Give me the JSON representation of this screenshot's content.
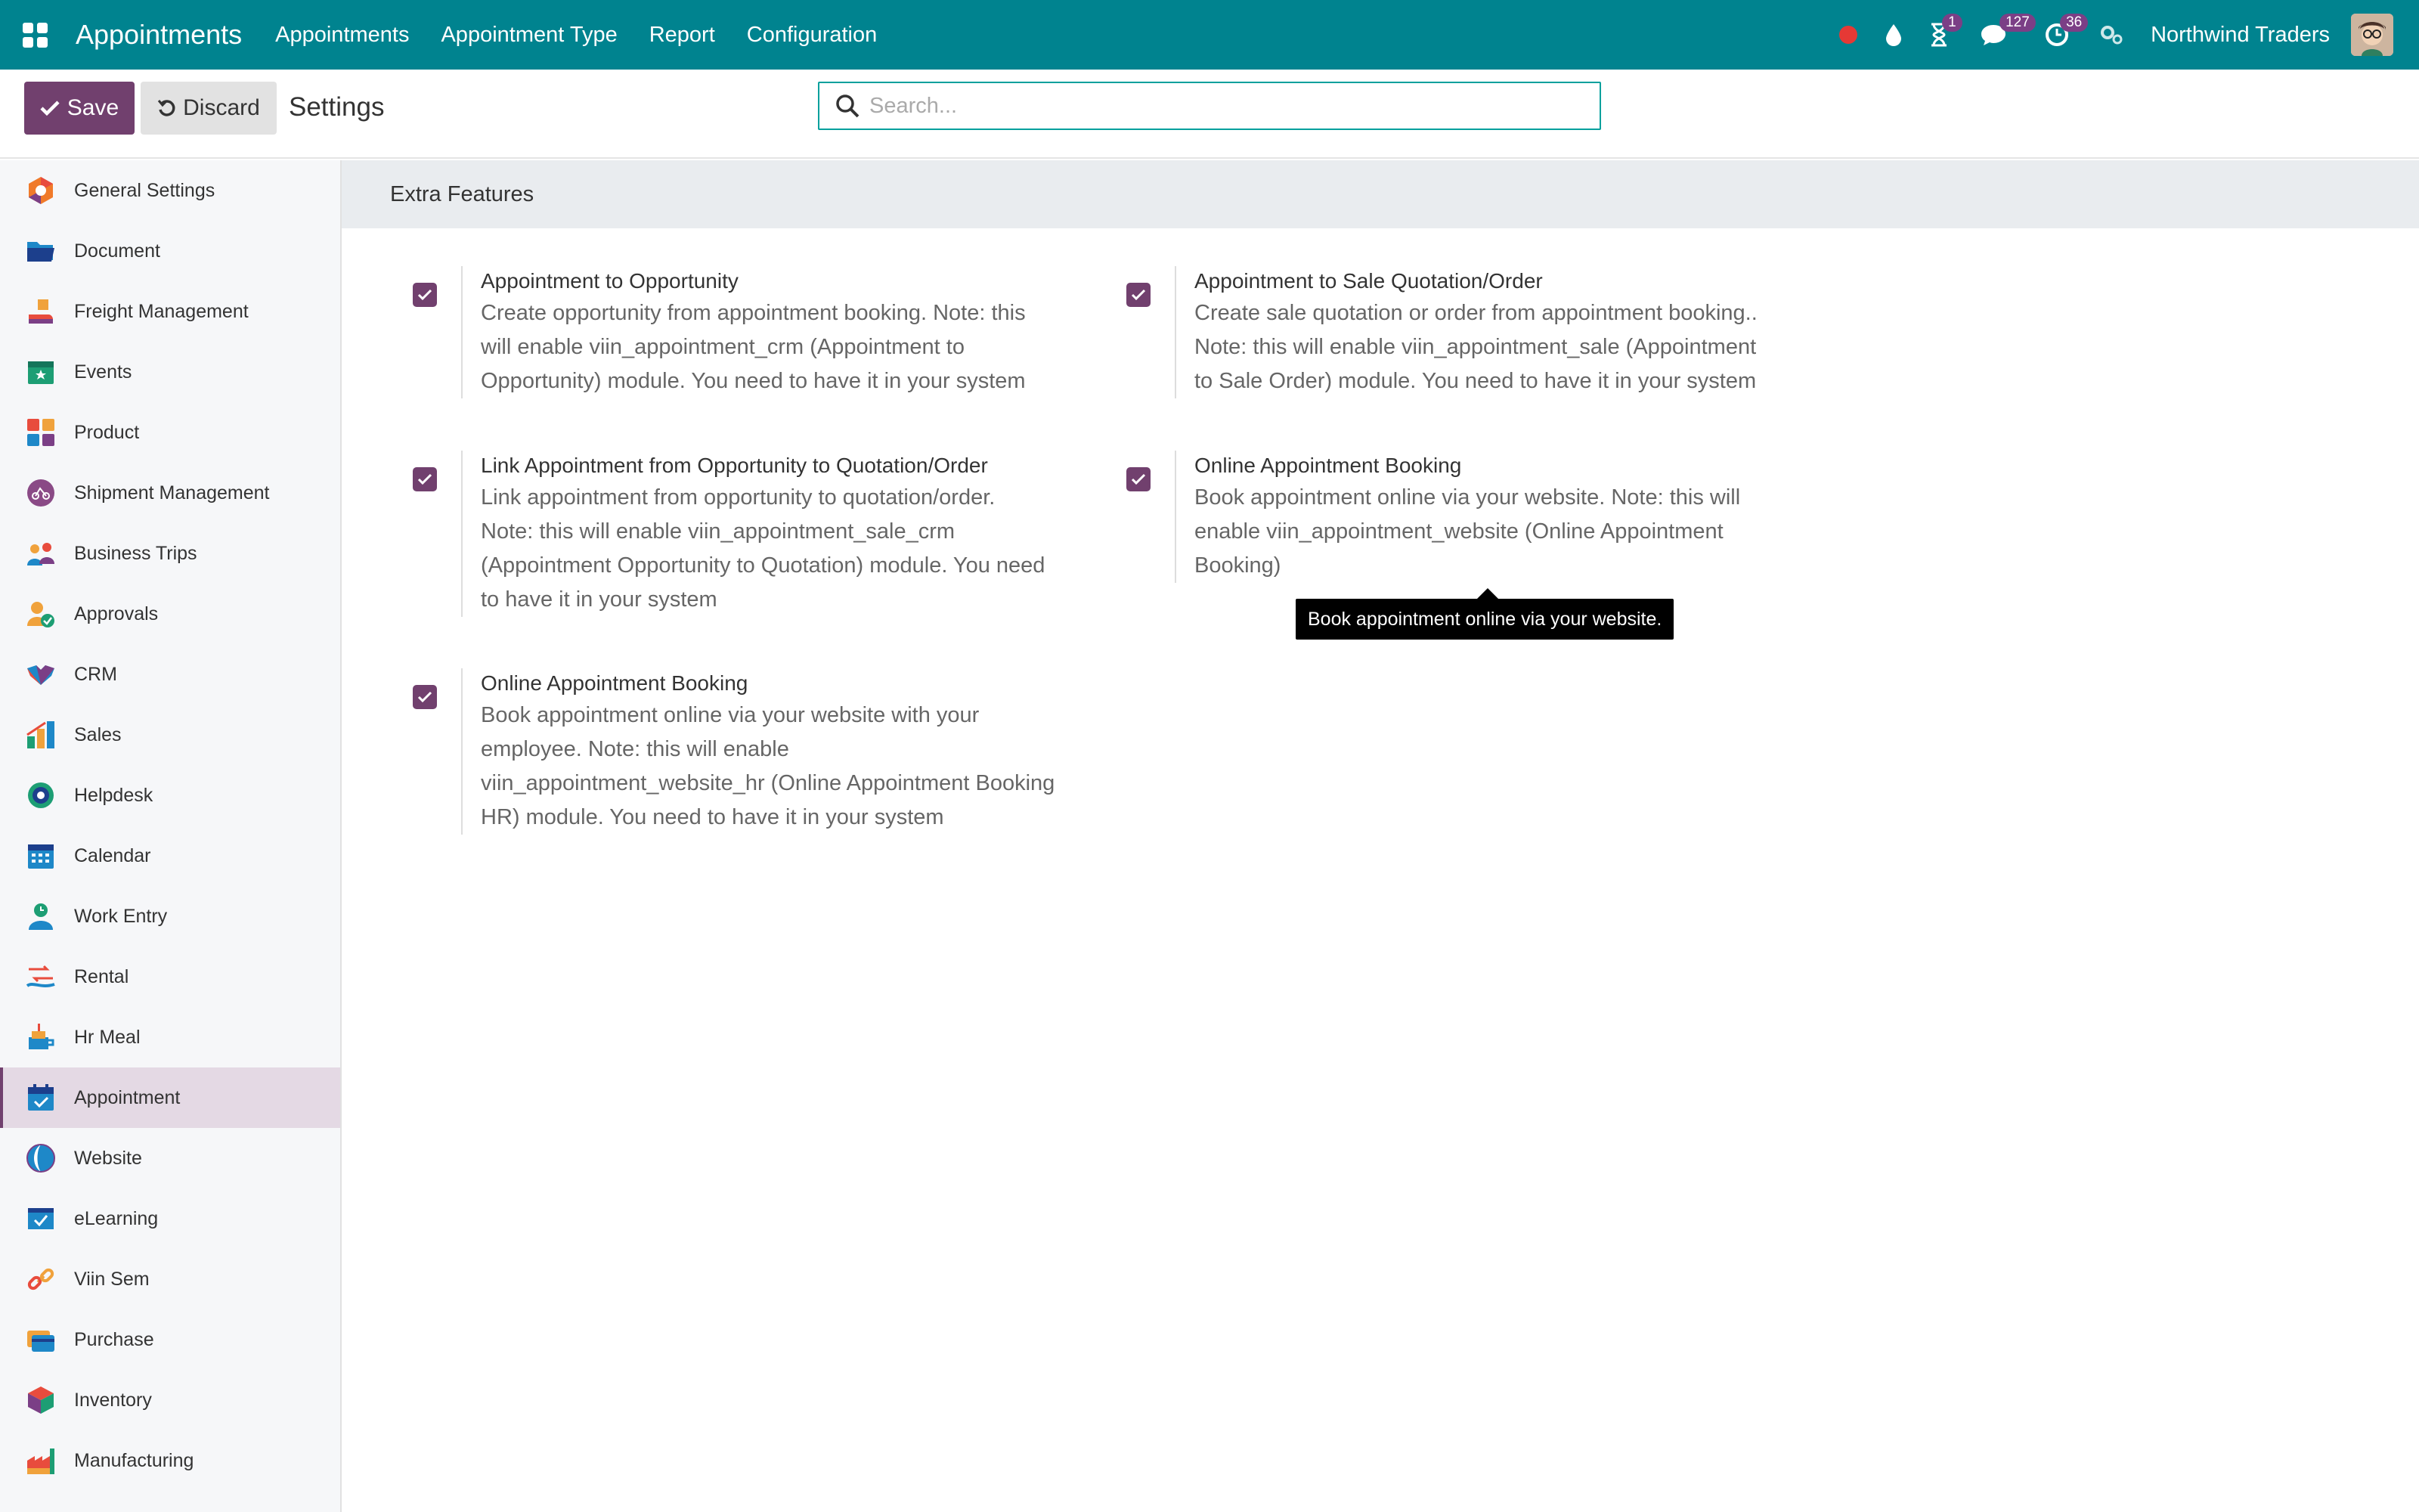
{
  "navbar": {
    "brand": "Appointments",
    "menu": [
      "Appointments",
      "Appointment Type",
      "Report",
      "Configuration"
    ],
    "activity_badge": "1",
    "messages_badge": "127",
    "timer_badge": "36",
    "company": "Northwind Traders"
  },
  "control": {
    "save_label": "Save",
    "discard_label": "Discard",
    "title": "Settings",
    "search_placeholder": "Search..."
  },
  "sidebar": {
    "items": [
      {
        "label": "General Settings",
        "icon": "general-settings-icon"
      },
      {
        "label": "Document",
        "icon": "folder-icon"
      },
      {
        "label": "Freight Management",
        "icon": "freight-icon"
      },
      {
        "label": "Events",
        "icon": "events-icon"
      },
      {
        "label": "Product",
        "icon": "product-icon"
      },
      {
        "label": "Shipment Management",
        "icon": "shipment-icon"
      },
      {
        "label": "Business Trips",
        "icon": "business-trips-icon"
      },
      {
        "label": "Approvals",
        "icon": "approvals-icon"
      },
      {
        "label": "CRM",
        "icon": "crm-icon"
      },
      {
        "label": "Sales",
        "icon": "sales-icon"
      },
      {
        "label": "Helpdesk",
        "icon": "helpdesk-icon"
      },
      {
        "label": "Calendar",
        "icon": "calendar-icon"
      },
      {
        "label": "Work Entry",
        "icon": "work-entry-icon"
      },
      {
        "label": "Rental",
        "icon": "rental-icon"
      },
      {
        "label": "Hr Meal",
        "icon": "hr-meal-icon"
      },
      {
        "label": "Appointment",
        "icon": "appointment-icon"
      },
      {
        "label": "Website",
        "icon": "website-icon"
      },
      {
        "label": "eLearning",
        "icon": "elearning-icon"
      },
      {
        "label": "Viin Sem",
        "icon": "viin-sem-icon"
      },
      {
        "label": "Purchase",
        "icon": "purchase-icon"
      },
      {
        "label": "Inventory",
        "icon": "inventory-icon"
      },
      {
        "label": "Manufacturing",
        "icon": "manufacturing-icon"
      }
    ]
  },
  "main": {
    "section_title": "Extra Features",
    "settings": [
      {
        "title": "Appointment to Opportunity",
        "desc_lines": [
          "Create opportunity from appointment booking. Note: this",
          "will enable viin_appointment_crm (Appointment to",
          "Opportunity) module. You need to have it in your system"
        ],
        "checked": true
      },
      {
        "title": "Appointment to Sale Quotation/Order",
        "desc_lines": [
          "Create sale quotation or order from appointment booking..",
          "Note: this will enable viin_appointment_sale (Appointment",
          "to Sale Order) module. You need to have it in your system"
        ],
        "checked": true
      },
      {
        "title": "Link Appointment from Opportunity to Quotation/Order",
        "desc_lines": [
          "Link appointment from opportunity to quotation/order.",
          "Note: this will enable viin_appointment_sale_crm",
          "(Appointment Opportunity to Quotation) module. You need",
          "to have it in your system"
        ],
        "checked": true
      },
      {
        "title": "Online Appointment Booking",
        "desc_lines": [
          "Book appointment online via your website. Note: this will",
          "enable viin_appointment_website (Online Appointment",
          "Booking)"
        ],
        "checked": true
      },
      {
        "title": "Online Appointment Booking",
        "desc_lines": [
          "Book appointment online via your website with your",
          "employee. Note: this will enable",
          "viin_appointment_website_hr (Online Appointment Booking",
          "HR) module. You need to have it in your system"
        ],
        "checked": true
      }
    ],
    "tooltip": "Book appointment online via your website."
  },
  "colors": {
    "navbar": "#00838f",
    "primary": "#71406e",
    "badge": "#7b3f86"
  }
}
